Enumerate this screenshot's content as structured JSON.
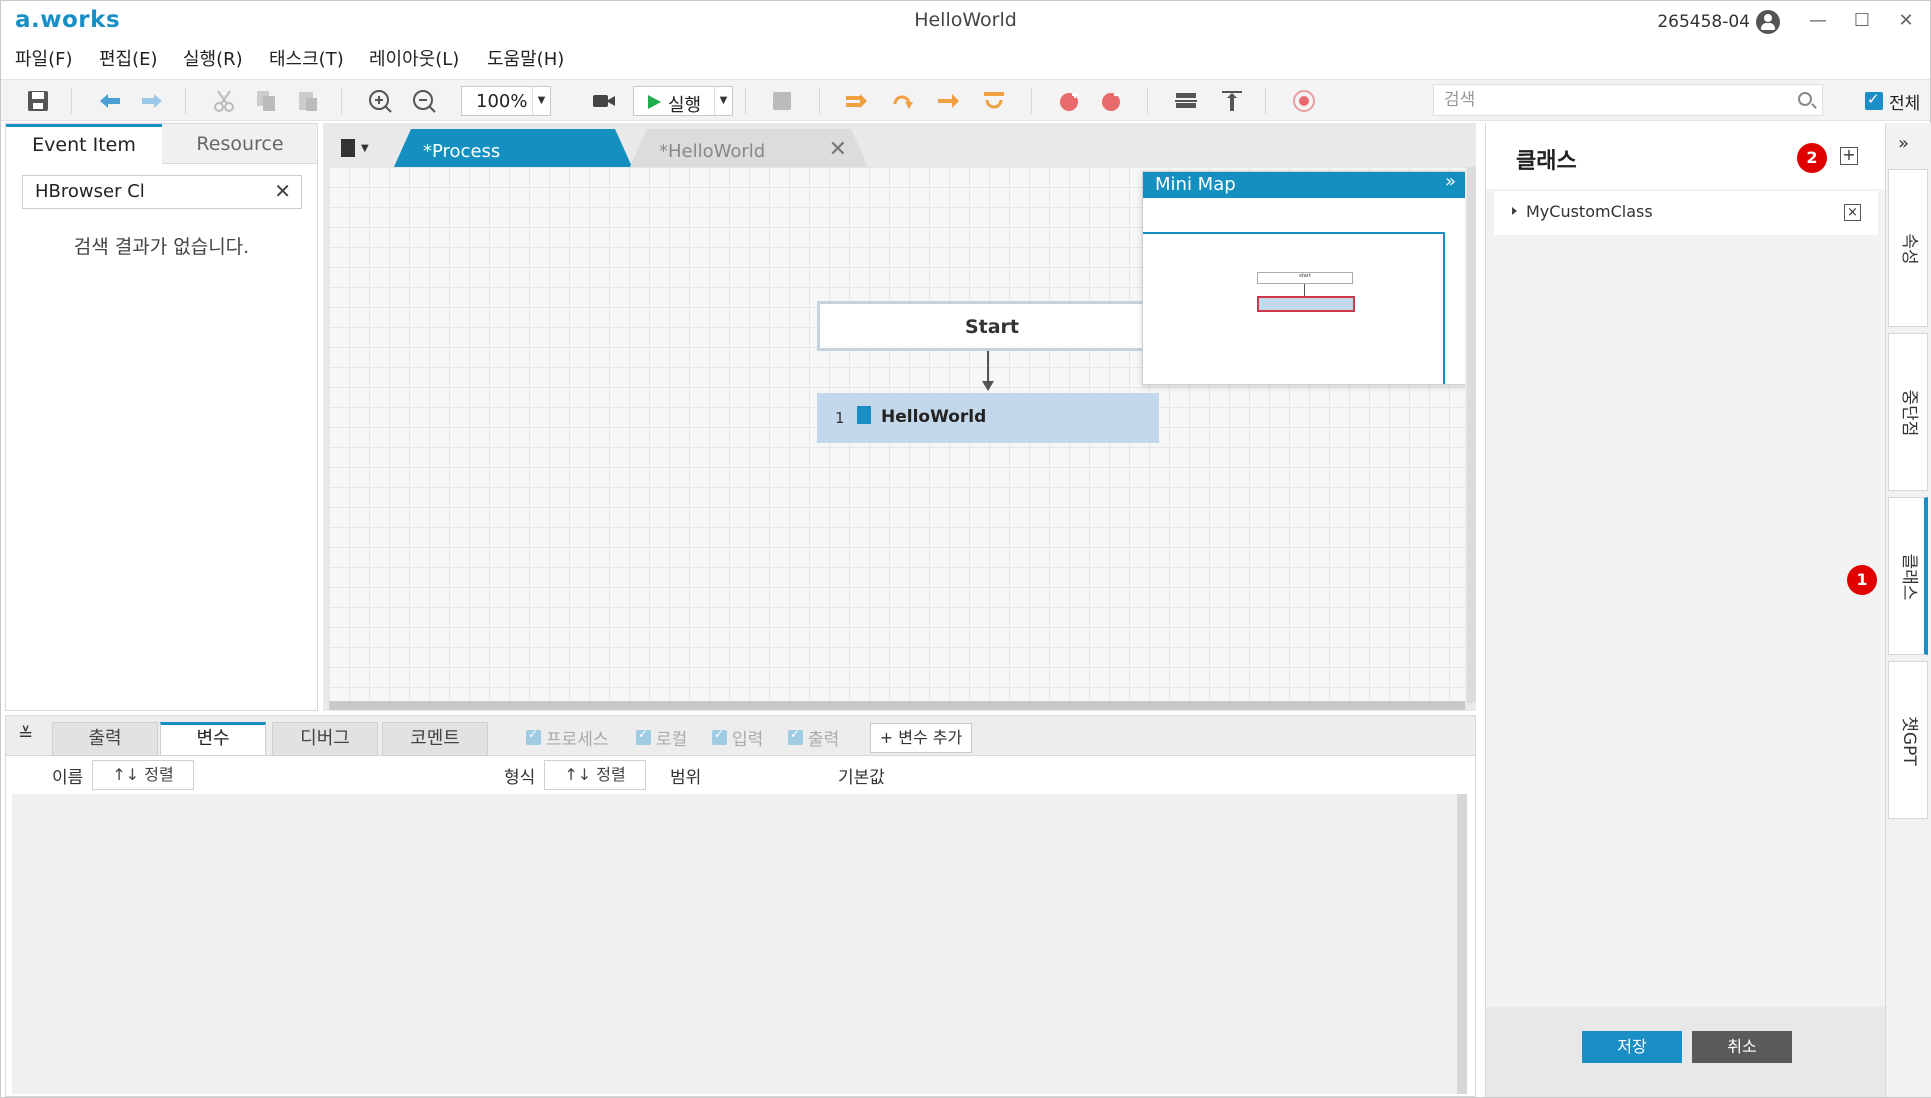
{
  "app": {
    "logo": "a.works",
    "title": "HelloWorld",
    "user_id": "265458-04",
    "window_controls": {
      "minimize": "—",
      "maximize": "☐",
      "close": "✕"
    }
  },
  "menu": [
    "파일(F)",
    "편집(E)",
    "실행(R)",
    "태스크(T)",
    "레이아웃(L)",
    "도움말(H)"
  ],
  "toolbar": {
    "zoom_value": "100%",
    "run_label": "실행",
    "search_placeholder": "검색",
    "search_all_label": "전체",
    "icons": [
      "save-icon",
      "back-icon",
      "forward-icon",
      "cut-icon",
      "copy-icon",
      "paste-icon",
      "zoom-in-icon",
      "zoom-out-icon",
      "record-icon",
      "stop-icon",
      "step-icons",
      "breakpoint-icons",
      "align-icons",
      "target-icon"
    ]
  },
  "left_panel": {
    "tabs": [
      "Event Item",
      "Resource"
    ],
    "search_value": "HBrowser Cl",
    "empty_message": "검색 결과가 없습니다."
  },
  "canvas": {
    "tabs": [
      {
        "label": "*Process",
        "active": true
      },
      {
        "label": "*HelloWorld",
        "active": false
      }
    ],
    "nodes": {
      "start": "Start",
      "step_number": "1",
      "step_label": "HelloWorld"
    },
    "minimap": {
      "title": "Mini Map",
      "collapse": "»",
      "start_label": "start"
    }
  },
  "bottom_panel": {
    "tabs": [
      "출력",
      "변수",
      "디버그",
      "코멘트"
    ],
    "active_tab": "변수",
    "filters": [
      "프로세스",
      "로컬",
      "입력",
      "출력"
    ],
    "add_variable": "+ 변수 추가",
    "columns": {
      "name": "이름",
      "sort": "↑↓ 정렬",
      "type": "형식",
      "scope": "범위",
      "default": "기본값"
    }
  },
  "right_panel": {
    "title": "클래스",
    "add": "+",
    "items": [
      {
        "label": "MyCustomClass",
        "remove": "×"
      }
    ],
    "save": "저장",
    "cancel": "취소"
  },
  "side_tabs": {
    "collapse": "»",
    "tabs": [
      "속성",
      "중단점",
      "클래스",
      "챗GPT"
    ],
    "active": "클래스"
  },
  "annotations": {
    "badge_1": "1",
    "badge_2": "2"
  }
}
